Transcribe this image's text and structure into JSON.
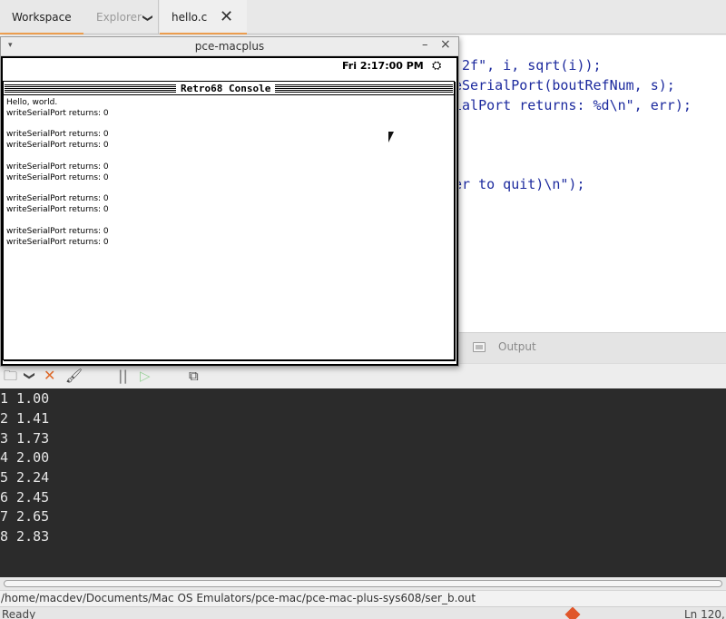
{
  "topbar": {
    "workspace_tab": "Workspace",
    "explorer_tab": "Explorer",
    "explorer_chevron": "❯",
    "file_tab": "hello.c",
    "file_tab_close": "✕"
  },
  "editor": {
    "line1": ".2f\", i, sqrt(i));",
    "line2": "eSerialPort(boutRefNum, s);",
    "line3": "ialPort returns: %d\\n\", err);",
    "line4": "er to quit)\\n\");"
  },
  "panel": {
    "output_tab": "Output"
  },
  "toolbar": {
    "folder_icon": "🗀",
    "chevron_icon": "❯",
    "clear_icon": "✕",
    "broom_icon": "🖌",
    "pause_icon": "||",
    "run_icon": "▷",
    "detach_icon": "⧉"
  },
  "terminal": {
    "lines": [
      "1 1.00",
      "2 1.41",
      "3 1.73",
      "4 2.00",
      "5 2.24",
      "6 2.45",
      "7 2.65",
      "8 2.83"
    ]
  },
  "path": "/home/macdev/Documents/Mac OS Emulators/pce-mac/pce-mac-plus-sys608/ser_b.out",
  "status": {
    "left": "Ready",
    "position": "Ln 120, Col 1"
  },
  "emulator_window": {
    "title": "pce-macplus",
    "menu_glyph": "▾",
    "minimize": "–",
    "close": "×",
    "clock": "Fri 2:17:00 PM",
    "app_icon": "⛭",
    "console_title": "Retro68 Console",
    "console_lines": [
      "Hello, world.",
      "writeSerialPort returns: 0",
      "",
      "writeSerialPort returns: 0",
      "writeSerialPort returns: 0",
      "",
      "writeSerialPort returns: 0",
      "writeSerialPort returns: 0",
      "",
      "writeSerialPort returns: 0",
      "writeSerialPort returns: 0",
      "",
      "writeSerialPort returns: 0",
      "writeSerialPort returns: 0"
    ]
  }
}
